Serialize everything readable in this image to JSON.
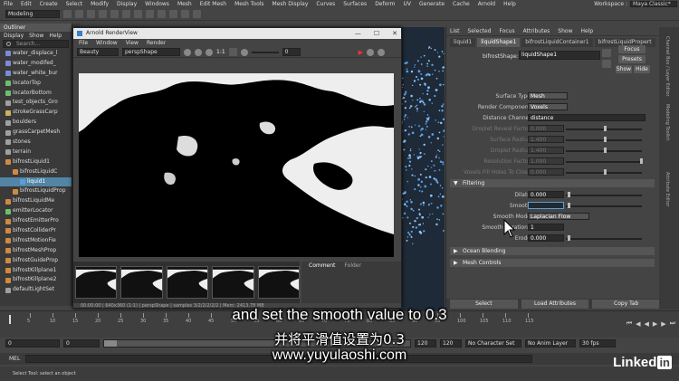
{
  "menubar": {
    "items": [
      "File",
      "Edit",
      "Create",
      "Select",
      "Modify",
      "Display",
      "Windows",
      "Mesh",
      "Edit Mesh",
      "Mesh Tools",
      "Mesh Display",
      "Curves",
      "Surfaces",
      "Deform",
      "UV",
      "Generate",
      "Cache",
      "Arnold",
      "Help"
    ],
    "workspace_label": "Workspace :",
    "workspace_value": "Maya Classic*"
  },
  "statusline": {
    "mode": "Modeling"
  },
  "outliner": {
    "title": "Outliner",
    "menu": [
      "Display",
      "Show",
      "Help"
    ],
    "search_placeholder": "Search...",
    "items": [
      {
        "label": "water_displace_l",
        "color": "#7a8bd9",
        "selected": false
      },
      {
        "label": "water_modifed_",
        "color": "#7a8bd9",
        "selected": false
      },
      {
        "label": "water_white_bur",
        "color": "#7a8bd9",
        "selected": false
      },
      {
        "label": "locatorTop",
        "color": "#6cc06c",
        "selected": false
      },
      {
        "label": "locatorBottom",
        "color": "#6cc06c",
        "selected": false
      },
      {
        "label": "test_objects_Gro",
        "color": "#a0a0a0",
        "selected": false
      },
      {
        "label": "strokeGrassCarp",
        "color": "#d0b060",
        "selected": false
      },
      {
        "label": "boulders",
        "color": "#a0a0a0",
        "selected": false
      },
      {
        "label": "grassCarpetMesh",
        "color": "#a0a0a0",
        "selected": false
      },
      {
        "label": "stones",
        "color": "#a0a0a0",
        "selected": false
      },
      {
        "label": "terrain",
        "color": "#a0a0a0",
        "selected": false
      },
      {
        "label": "bifrostLiquid1",
        "color": "#d08a40",
        "selected": false
      },
      {
        "label": "bifrostLiquidC",
        "color": "#d08a40",
        "selected": false
      },
      {
        "label": "liquid1",
        "color": "#5aa0d8",
        "selected": true
      },
      {
        "label": "bifrostLiquidProp",
        "color": "#d08a40",
        "selected": false
      },
      {
        "label": "bifrostLiquidMe",
        "color": "#d08a40",
        "selected": false
      },
      {
        "label": "emitterLocator",
        "color": "#6cc06c",
        "selected": false
      },
      {
        "label": "bifrostEmitterPro",
        "color": "#d08a40",
        "selected": false
      },
      {
        "label": "bifrostColliderPr",
        "color": "#d08a40",
        "selected": false
      },
      {
        "label": "bifrostMotionFie",
        "color": "#d08a40",
        "selected": false
      },
      {
        "label": "bifrostMeshProp",
        "color": "#d08a40",
        "selected": false
      },
      {
        "label": "bifrostGuideProp",
        "color": "#d08a40",
        "selected": false
      },
      {
        "label": "bifrostKillplane1",
        "color": "#d08a40",
        "selected": false
      },
      {
        "label": "bifrostKillplane2",
        "color": "#d08a40",
        "selected": false
      },
      {
        "label": "defaultLightSet",
        "color": "#a0a0a0",
        "selected": false
      }
    ]
  },
  "renderview": {
    "title": "Arnold RenderView",
    "menu": [
      "File",
      "Window",
      "View",
      "Render"
    ],
    "aov": "Beauty",
    "camera": "perspShape",
    "ratio": "1:1",
    "exposure": "0",
    "side_tabs": [
      "Comment",
      "Folder"
    ],
    "status": "00:00:00 | 640x360 (1:1) | perspShape | samples 3/2/2/2/2/2 | Mem: 2413.78 MB"
  },
  "attribute_editor": {
    "menu": [
      "List",
      "Selected",
      "Focus",
      "Attributes",
      "Show",
      "Help"
    ],
    "tabs": [
      {
        "label": "liquid1",
        "active": false
      },
      {
        "label": "liquidShape1",
        "active": true
      },
      {
        "label": "bifrostLiquidContainer1",
        "active": false
      },
      {
        "label": "bifrostLiquidPropert",
        "active": false
      }
    ],
    "node_label": "bifrostShape:",
    "node_value": "liquidShape1",
    "focus_btn": "Focus",
    "presets_btn": "Presets",
    "show_btn": "Show",
    "hide_btn": "Hide",
    "attrs_top": [
      {
        "label": "Surface Type",
        "value": "Mesh",
        "type": "dropdown",
        "dim": false
      },
      {
        "label": "Render Component",
        "value": "Voxels",
        "type": "dropdown",
        "dim": false
      },
      {
        "label": "Distance Channel",
        "value": "distance",
        "type": "text",
        "dim": false
      },
      {
        "label": "Droplet Reveal Factor",
        "value": "0.000",
        "type": "slider",
        "dim": true,
        "knob": 0.5
      },
      {
        "label": "Surface Radius",
        "value": "1.400",
        "type": "slider",
        "dim": true,
        "knob": 0.5
      },
      {
        "label": "Droplet Radius",
        "value": "1.400",
        "type": "slider",
        "dim": true,
        "knob": 0.5
      },
      {
        "label": "Resolution Factor",
        "value": "1.000",
        "type": "slider",
        "dim": true,
        "knob": 0.98
      },
      {
        "label": "Voxels Fill Holes To Close",
        "value": "0.000",
        "type": "slider",
        "dim": true,
        "knob": 0.5
      }
    ],
    "section_filtering": "Filtering",
    "attrs_filter": [
      {
        "label": "Dilate",
        "value": "0.000",
        "type": "slider",
        "dim": false,
        "knob": 0.02
      },
      {
        "label": "Smooth",
        "value": "",
        "type": "slider",
        "dim": false,
        "knob": 0.02
      },
      {
        "label": "Smooth Mode",
        "value": "Laplacian Flow",
        "type": "dropdown",
        "dim": false
      },
      {
        "label": "Smooth Iterations",
        "value": "1",
        "type": "int",
        "dim": false
      },
      {
        "label": "Erode",
        "value": "0.000",
        "type": "slider",
        "dim": false,
        "knob": 0.02
      }
    ],
    "section_ocean": "Ocean Blending",
    "section_mesh": "Mesh Controls",
    "bottom_buttons": [
      "Select",
      "Load Attributes",
      "Copy Tab"
    ]
  },
  "right_strip_tabs": [
    "Channel Box / Layer Editor",
    "Modeling Toolkit",
    "Attribute Editor"
  ],
  "timeslider": {
    "tick_labels": [
      "5",
      "10",
      "15",
      "20",
      "25",
      "30",
      "35",
      "40",
      "45",
      "50",
      "55",
      "60",
      "65",
      "70",
      "75",
      "80",
      "85",
      "90",
      "95",
      "100",
      "105",
      "110",
      "115"
    ],
    "current_frame": "1"
  },
  "rangebar": {
    "start": "0",
    "start2": "0",
    "end": "120",
    "end2": "120",
    "character_set": "No Character Set",
    "anim_layer": "No Anim Layer",
    "fps": "30 fps"
  },
  "mel": {
    "label": "MEL"
  },
  "helpline": "Select Tool: select an object",
  "subtitles": {
    "en": "and set the smooth value to 0.3",
    "zh": "并将平滑值设置为0.3",
    "url": "www.yuyulaoshi.com"
  },
  "watermark": {
    "a": "Linked",
    "b": "in"
  }
}
